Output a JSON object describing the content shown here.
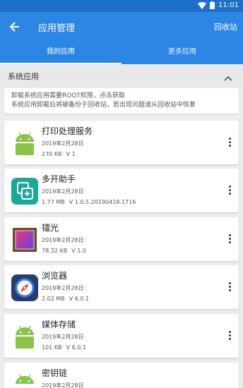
{
  "status_bar": {
    "time": "11:01"
  },
  "toolbar": {
    "title": "应用管理",
    "recycle_label": "回收站"
  },
  "tabs": [
    {
      "label": "我的应用",
      "active": true
    },
    {
      "label": "更多应用",
      "active": false
    }
  ],
  "section": {
    "title": "系统应用"
  },
  "notice": {
    "line1": "卸载系统应用需要ROOT权限，点击获取",
    "line2": "系统应用卸载后将被备份于回收站，若出现问题请从回收站中恢复"
  },
  "apps": [
    {
      "name": "打印处理服务",
      "date": "2019年2月28日",
      "size": "270 KB",
      "version": "V 1",
      "icon": "android-icon"
    },
    {
      "name": "多开助手",
      "date": "2019年2月28日",
      "size": "1.77 MB",
      "version": "V 1.0.5.20190418.1716",
      "icon": "multi-open-icon"
    },
    {
      "name": "镭光",
      "date": "2019年2月28日",
      "size": "78.32 KB",
      "version": "V 1.0",
      "icon": "picture-frame-icon"
    },
    {
      "name": "浏览器",
      "date": "2019年2月28日",
      "size": "2.02 MB",
      "version": "V 6.0.1",
      "icon": "compass-icon"
    },
    {
      "name": "媒体存储",
      "date": "2019年2月28日",
      "size": "101 KB",
      "version": "V 6.0.1",
      "icon": "android-icon"
    },
    {
      "name": "密钥链",
      "date": "2019年2月28日",
      "size": "",
      "version": "",
      "icon": "android-icon"
    }
  ],
  "colors": {
    "toolbar": "#2b87e3",
    "status_bar": "#1e6fc9",
    "android_green": "#8bc34a"
  }
}
